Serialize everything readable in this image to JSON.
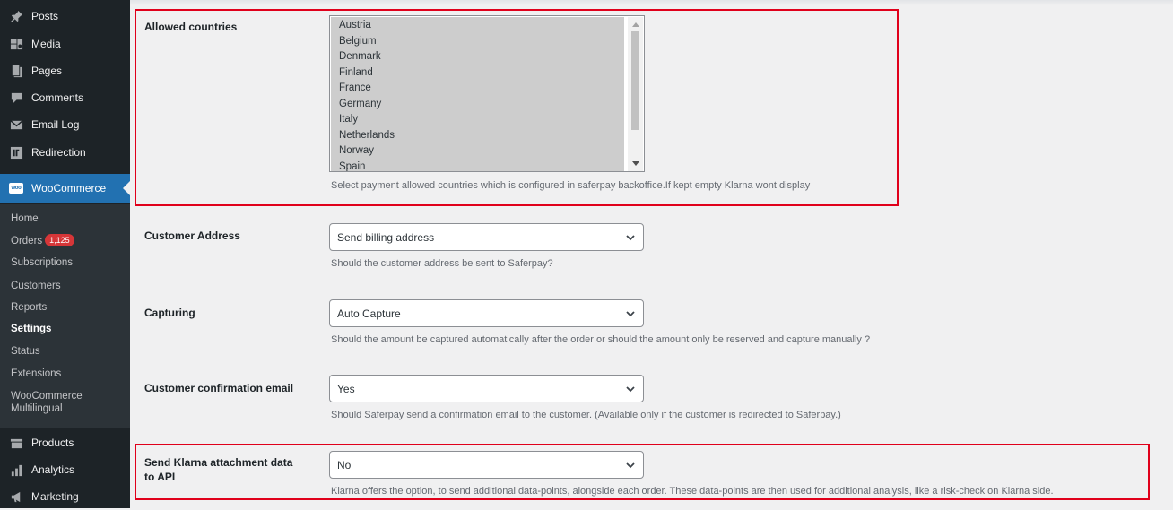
{
  "sidebar": {
    "top_items": [
      {
        "label": "Posts",
        "icon": "pin-icon"
      },
      {
        "label": "Media",
        "icon": "media-icon"
      },
      {
        "label": "Pages",
        "icon": "pages-icon"
      },
      {
        "label": "Comments",
        "icon": "comment-icon"
      },
      {
        "label": "Email Log",
        "icon": "mail-icon"
      },
      {
        "label": "Redirection",
        "icon": "redirection-icon"
      }
    ],
    "active_item": {
      "label": "WooCommerce",
      "logo_text": "woo"
    },
    "submenu": [
      {
        "label": "Home"
      },
      {
        "label": "Orders",
        "badge": "1,125"
      },
      {
        "label": "Subscriptions"
      },
      {
        "label": "Customers"
      },
      {
        "label": "Reports"
      },
      {
        "label": "Settings",
        "current": true
      },
      {
        "label": "Status"
      },
      {
        "label": "Extensions"
      },
      {
        "label": "WooCommerce",
        "label2": "Multilingual"
      }
    ],
    "bottom_items": [
      {
        "label": "Products",
        "icon": "products-icon"
      },
      {
        "label": "Analytics",
        "icon": "analytics-icon"
      },
      {
        "label": "Marketing",
        "icon": "megaphone-icon"
      }
    ]
  },
  "settings": {
    "allowed_countries": {
      "label": "Allowed countries",
      "options": [
        "Austria",
        "Belgium",
        "Denmark",
        "Finland",
        "France",
        "Germany",
        "Italy",
        "Netherlands",
        "Norway",
        "Spain"
      ],
      "description": "Select payment allowed countries which is configured in saferpay backoffice.If kept empty Klarna wont display"
    },
    "customer_address": {
      "label": "Customer Address",
      "value": "Send billing address",
      "description": "Should the customer address be sent to Saferpay?"
    },
    "capturing": {
      "label": "Capturing",
      "value": "Auto Capture",
      "description": "Should the amount be captured automatically after the order or should the amount only be reserved and capture manually ?"
    },
    "confirmation_email": {
      "label": "Customer confirmation email",
      "value": "Yes",
      "description": "Should Saferpay send a confirmation email to the customer. (Available only if the customer is redirected to Saferpay.)"
    },
    "klarna_attachment": {
      "label_line1": "Send Klarna attachment data",
      "label_line2": "to API",
      "value": "No",
      "description": "Klarna offers the option, to send additional data-points, alongside each order. These data-points are then used for additional analysis, like a risk-check on Klarna side."
    }
  },
  "colors": {
    "sidebar_bg": "#1d2327",
    "submenu_bg": "#2c3338",
    "active_bg": "#2271b1",
    "badge_bg": "#d63638",
    "highlight_border": "#e0001b"
  }
}
